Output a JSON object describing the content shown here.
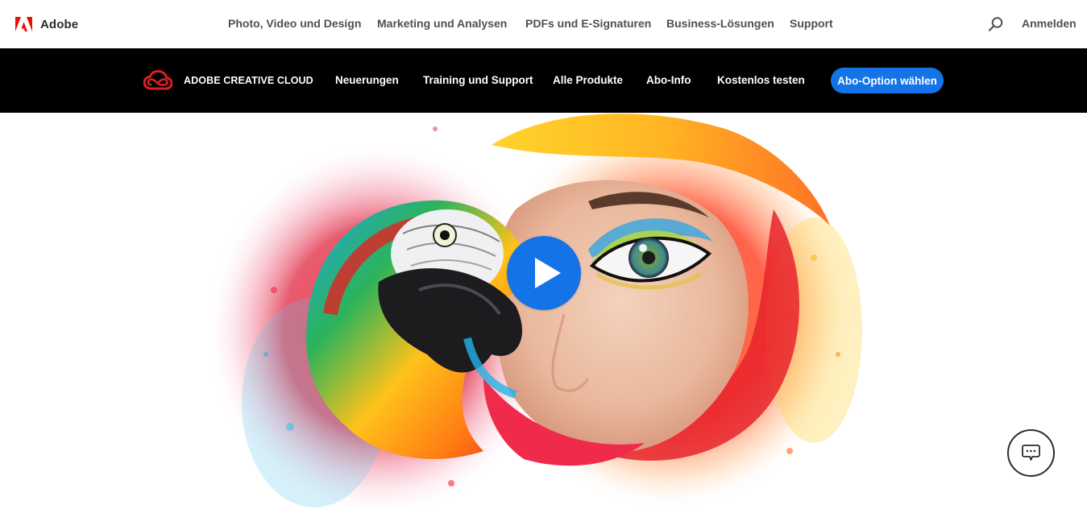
{
  "global_nav": {
    "brand": "Adobe",
    "items": [
      {
        "label": "Photo, Video und Design"
      },
      {
        "label": "Marketing und Analysen"
      },
      {
        "label": "PDFs und E-Signaturen"
      },
      {
        "label": "Business-Lösungen"
      },
      {
        "label": "Support"
      }
    ],
    "search_icon": "search-icon",
    "sign_in": "Anmelden"
  },
  "local_nav": {
    "product_title": "ADOBE CREATIVE CLOUD",
    "items": [
      {
        "label": "Neuerungen"
      },
      {
        "label": "Training und Support"
      },
      {
        "label": "Alle Produkte"
      },
      {
        "label": "Abo-Info"
      },
      {
        "label": "Kostenlos testen"
      }
    ],
    "cta": "Abo-Option wählen"
  },
  "hero": {
    "image": "parrot-and-woman-eye-colorful-feathers",
    "play_icon": "play-icon"
  },
  "chat": {
    "icon": "chat-bubble-icon"
  },
  "colors": {
    "brand_red": "#eb1000",
    "cta_blue": "#1473e6",
    "local_nav_bg": "#000000",
    "cc_red": "#da1f26"
  }
}
